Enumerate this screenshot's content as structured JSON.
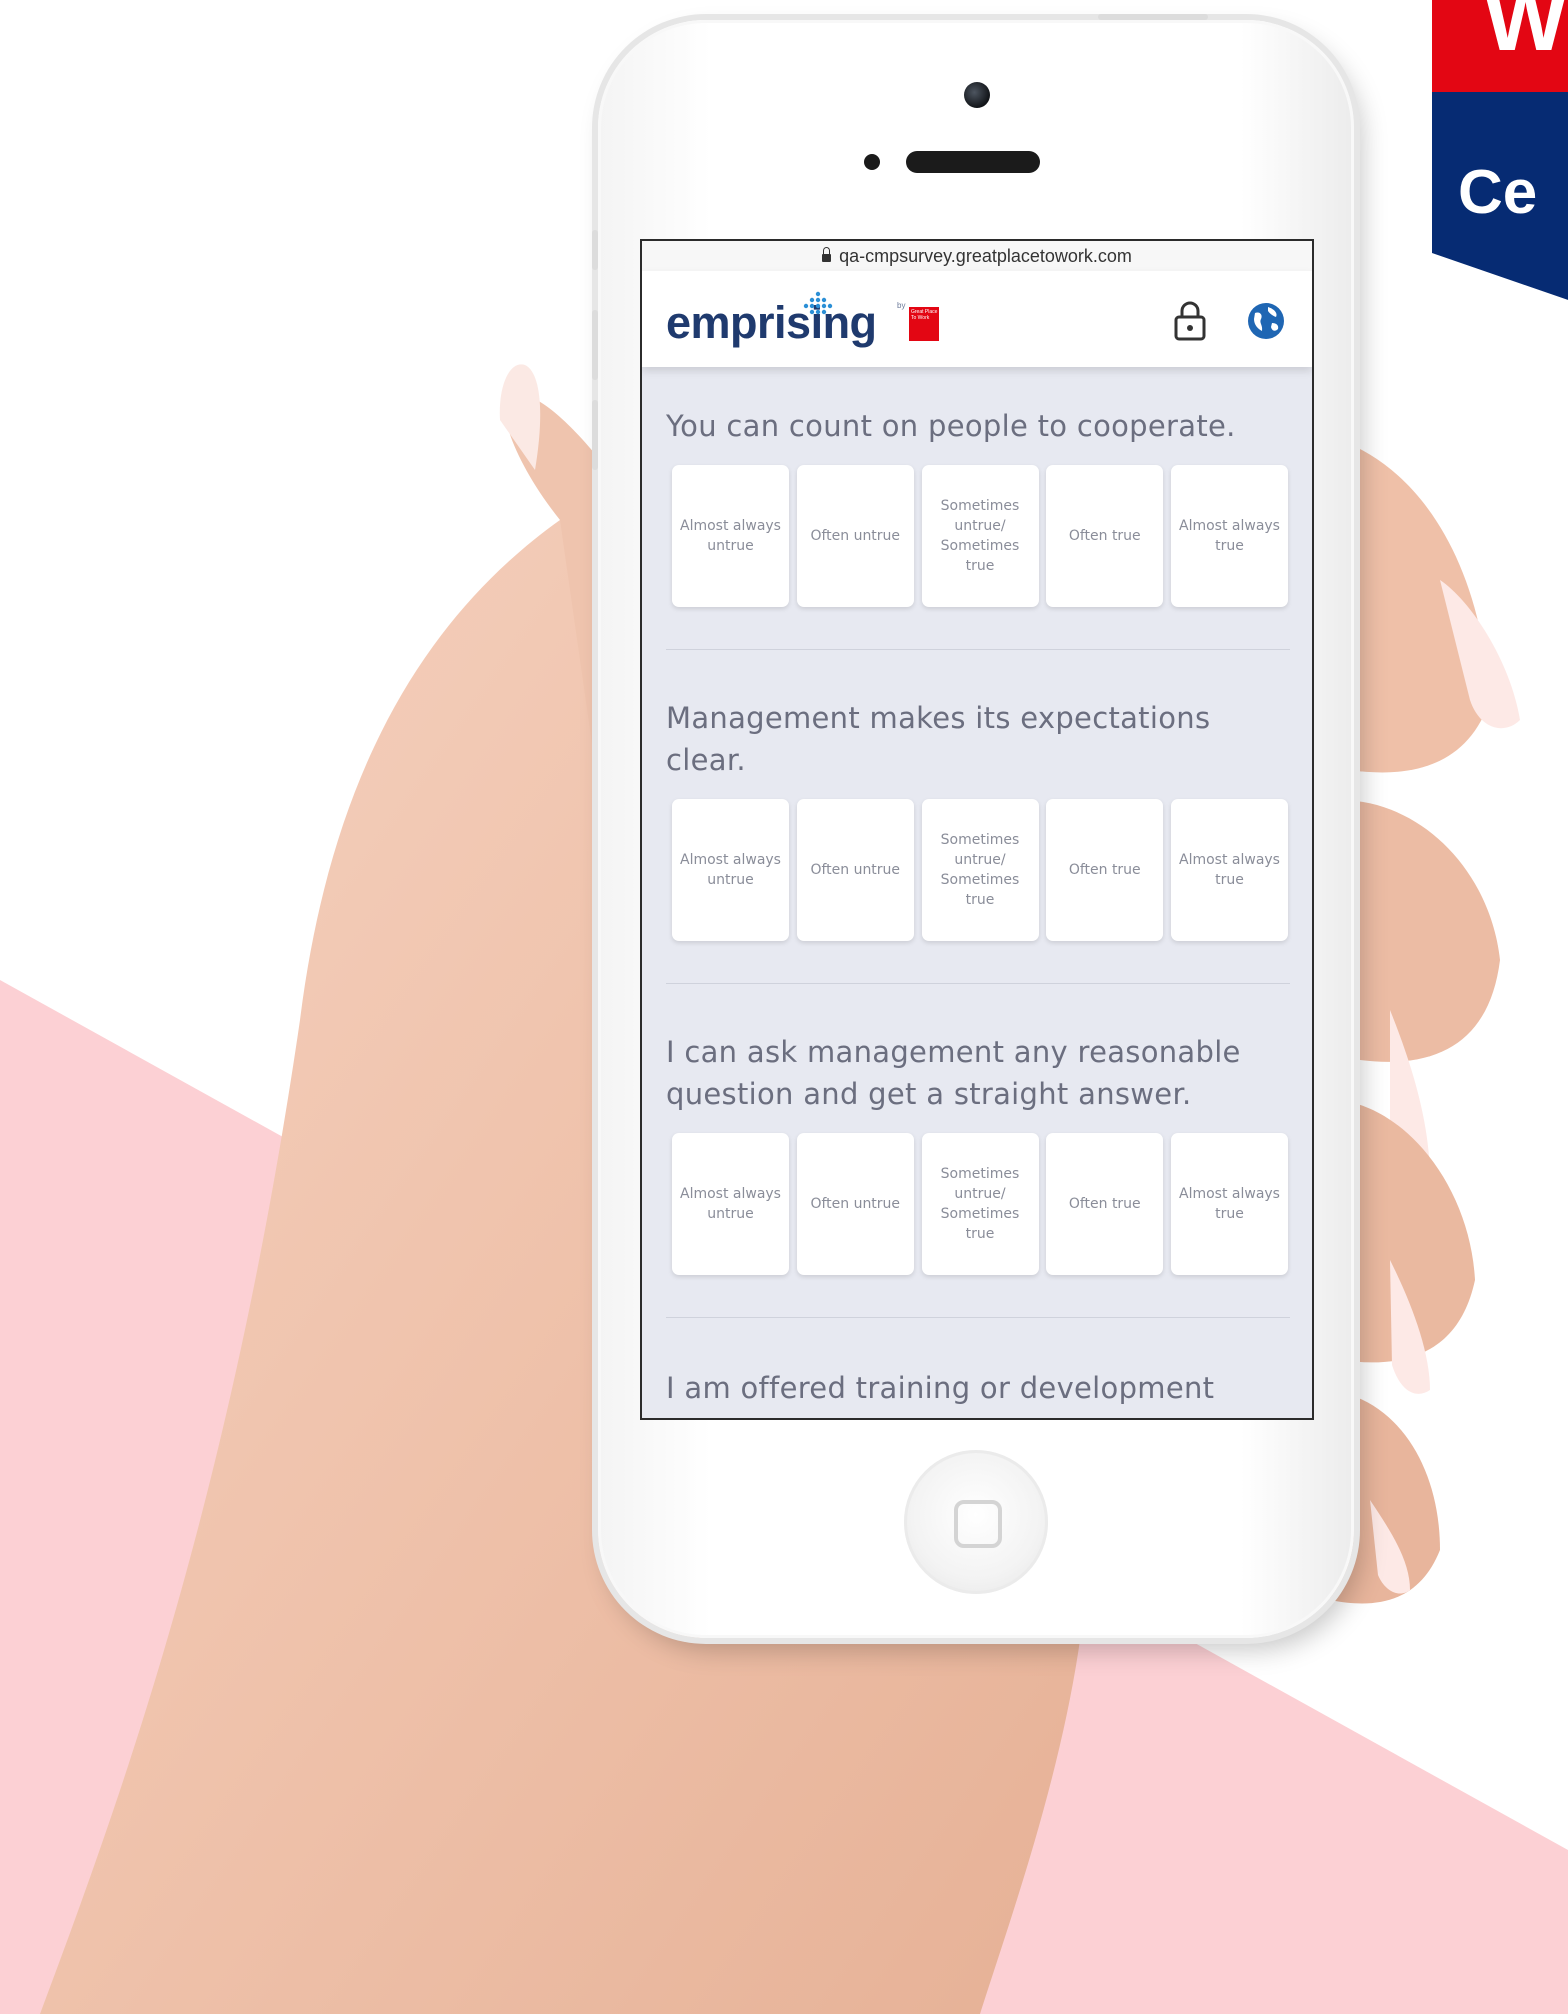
{
  "badge": {
    "line1": "W",
    "line2": "Ce"
  },
  "browser": {
    "url": "qa-cmpsurvey.greatplacetowork.com"
  },
  "app": {
    "logo_text": "emprising",
    "logo_by": "by",
    "partner_mark": "Great Place To Work",
    "lock_icon": "lock-icon",
    "globe_icon": "globe-icon"
  },
  "survey": {
    "questions": [
      {
        "text": "You can count on people to cooperate.",
        "options": [
          "Almost always untrue",
          "Often untrue",
          "Sometimes untrue/ Sometimes true",
          "Often true",
          "Almost always true"
        ]
      },
      {
        "text": "Management makes its expectations clear.",
        "options": [
          "Almost always untrue",
          "Often untrue",
          "Sometimes untrue/ Sometimes true",
          "Often true",
          "Almost always true"
        ]
      },
      {
        "text": "I can ask management any reasonable question and get a straight answer.",
        "options": [
          "Almost always untrue",
          "Often untrue",
          "Sometimes untrue/ Sometimes true",
          "Often true",
          "Almost always true"
        ]
      },
      {
        "text": "I am offered training or development"
      }
    ]
  },
  "colors": {
    "brand_blue": "#1f3a6e",
    "gptw_red": "#e30613",
    "badge_navy": "#062b73",
    "screen_bg": "#e7e9f1",
    "pink_bg": "#fcd0d4"
  }
}
